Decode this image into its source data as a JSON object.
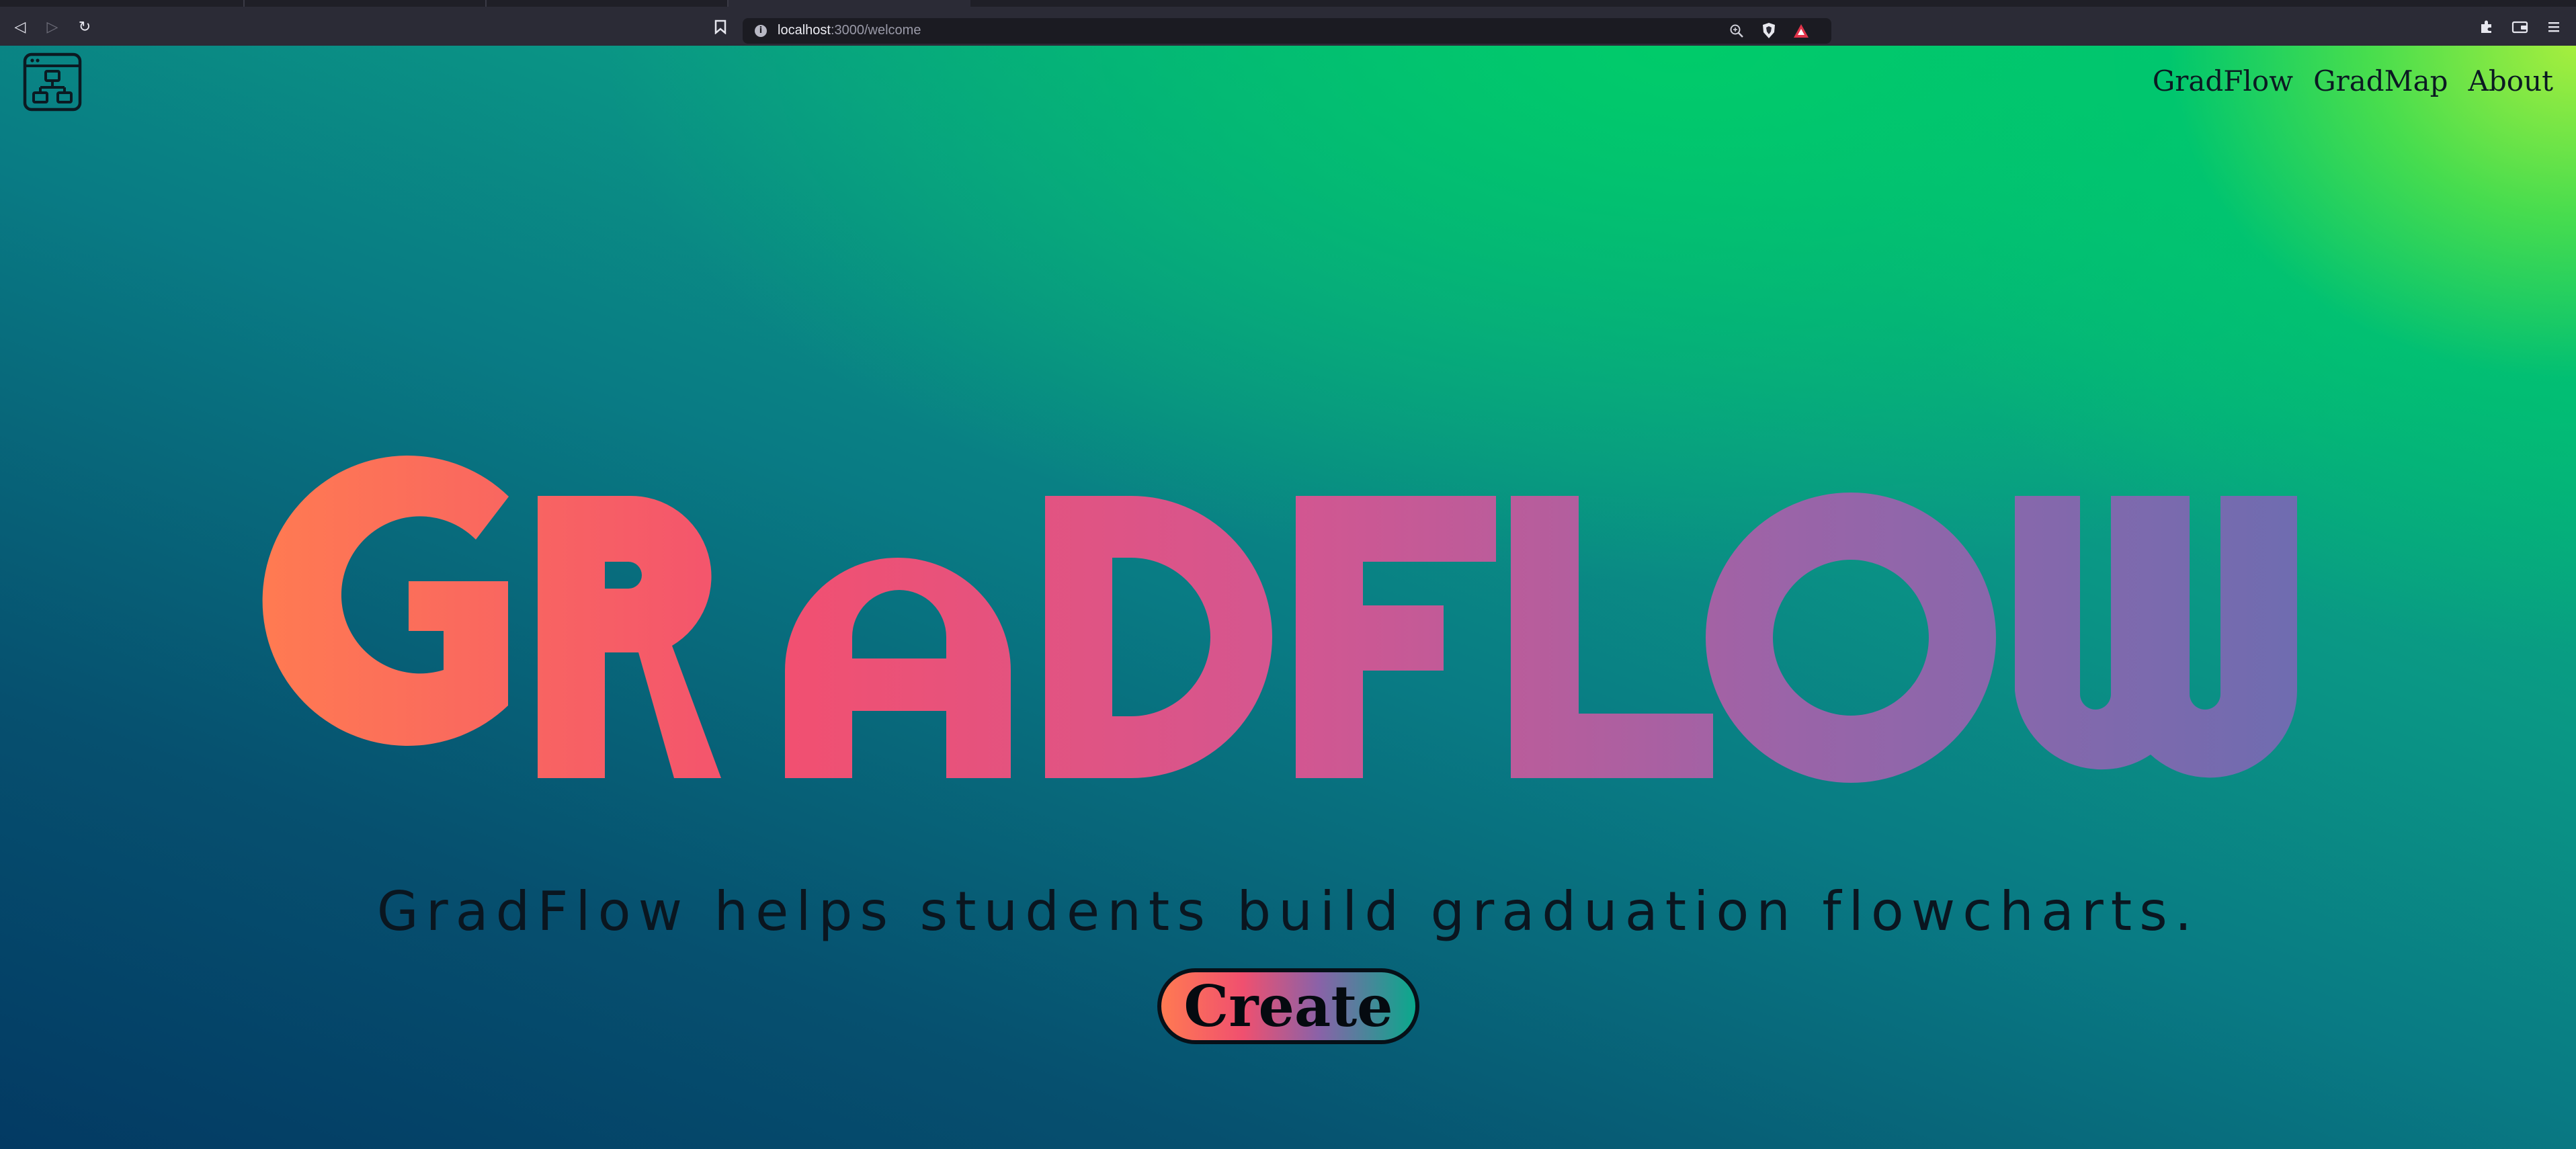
{
  "browser": {
    "url_host": "localhost",
    "url_path": ":3000/welcome",
    "icons": {
      "back": "back-icon",
      "forward": "forward-icon",
      "reload": "reload-icon",
      "bookmark": "bookmark-icon",
      "site_info": "info-icon",
      "zoom": "zoom-icon",
      "brave_shields": "brave-shield-icon",
      "brave_rewards": "brave-rewards-icon",
      "extensions": "puzzle-icon",
      "wallet": "wallet-icon",
      "menu": "hamburger-menu-icon"
    }
  },
  "nav": {
    "items": [
      {
        "label": "GradFlow"
      },
      {
        "label": "GradMap"
      },
      {
        "label": "About"
      }
    ]
  },
  "hero": {
    "title": "GRADFLOW",
    "gradient": [
      "#ff7a52",
      "#f25070",
      "#d45690",
      "#9a64a8",
      "#6f6cb0"
    ],
    "tagline": "GradFlow helps students build graduation flowcharts.",
    "cta_label": "Create"
  },
  "colors": {
    "text_dark": "#0b1a22",
    "bg_dark_blue": "#033a63",
    "bg_teal": "#0a9785",
    "bg_green": "#00c46a",
    "bg_lime": "#a6ee3e"
  }
}
